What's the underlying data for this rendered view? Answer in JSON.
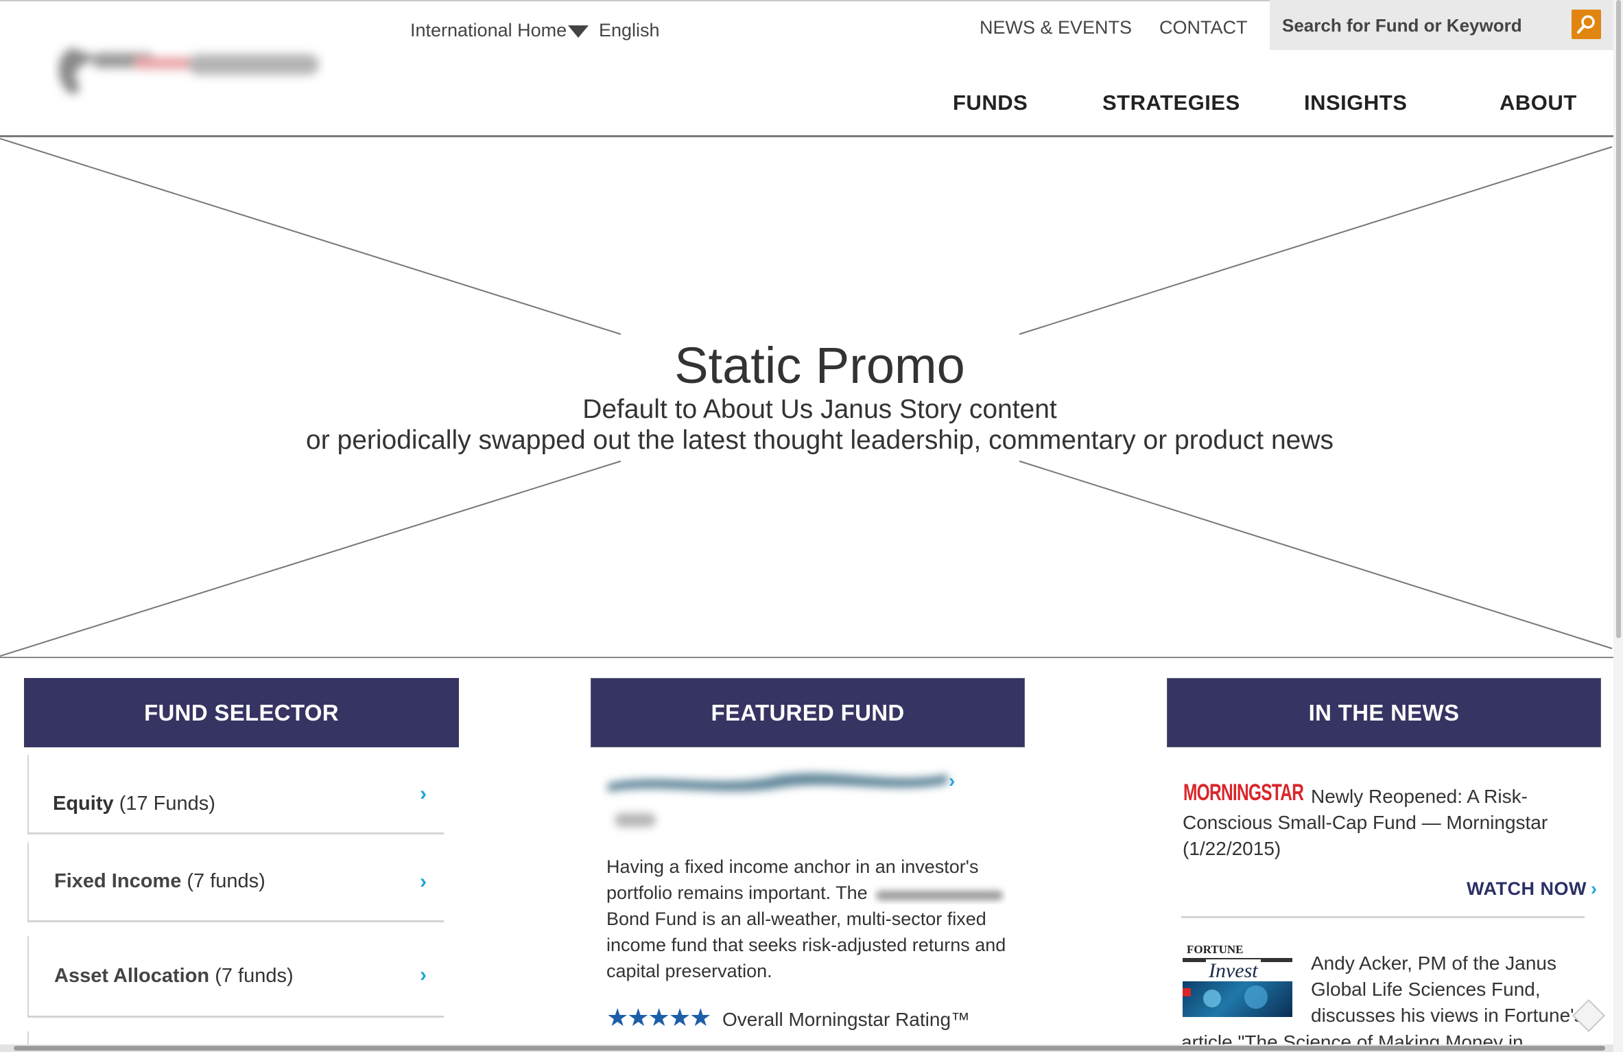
{
  "header": {
    "utility": {
      "international_home": "International Home",
      "language": "English",
      "news_events": "NEWS & EVENTS",
      "contact": "CONTACT"
    },
    "search": {
      "placeholder": "Search for Fund or Keyword"
    },
    "nav": [
      "FUNDS",
      "STRATEGIES",
      "INSIGHTS",
      "ABOUT"
    ]
  },
  "promo": {
    "title": "Static Promo",
    "line1": "Default to About Us Janus Story content",
    "line2": "or periodically swapped out the latest thought leadership, commentary or product news"
  },
  "fund_selector": {
    "heading": "FUND SELECTOR",
    "items": [
      {
        "name": "Equity",
        "count": "(17 Funds)"
      },
      {
        "name": "Fixed Income",
        "count": "(7 funds)"
      },
      {
        "name": "Asset Allocation",
        "count": "(7 funds)"
      }
    ]
  },
  "featured_fund": {
    "heading": "FEATURED FUND",
    "description_1": "Having a fixed income anchor in an investor's",
    "description_2": "portfolio remains important. The",
    "description_3": "Bond Fund is an all-weather, multi-sector fixed income fund that seeks risk-adjusted returns and capital preservation.",
    "stars": "★★★★★",
    "rating_label": "Overall Morningstar Rating™"
  },
  "in_the_news": {
    "heading": "IN THE NEWS",
    "items": [
      {
        "source_logo": "MORNINGSTAR",
        "line1": "Newly Reopened: A Risk-",
        "rest": "Conscious Small-Cap Fund — Morningstar (1/22/2015)",
        "cta": "WATCH NOW"
      },
      {
        "source_logo_top": "FORTUNE",
        "source_logo_bottom": "Invest",
        "text": "Andy Acker, PM of the Janus Global Life Sciences Fund, discusses his views in Fortune's",
        "cut_text": "article \"The Science of Making Money in"
      }
    ]
  },
  "colors": {
    "section_header_bg": "#363462",
    "accent_orange": "#e0850f",
    "chevron_blue": "#1fa6d8",
    "star_blue": "#1d5ea8",
    "morningstar_red": "#d9262b"
  },
  "icons": {
    "search": "magnifier-icon",
    "chevron": "chevron-right-icon",
    "caret": "caret-down-icon"
  }
}
